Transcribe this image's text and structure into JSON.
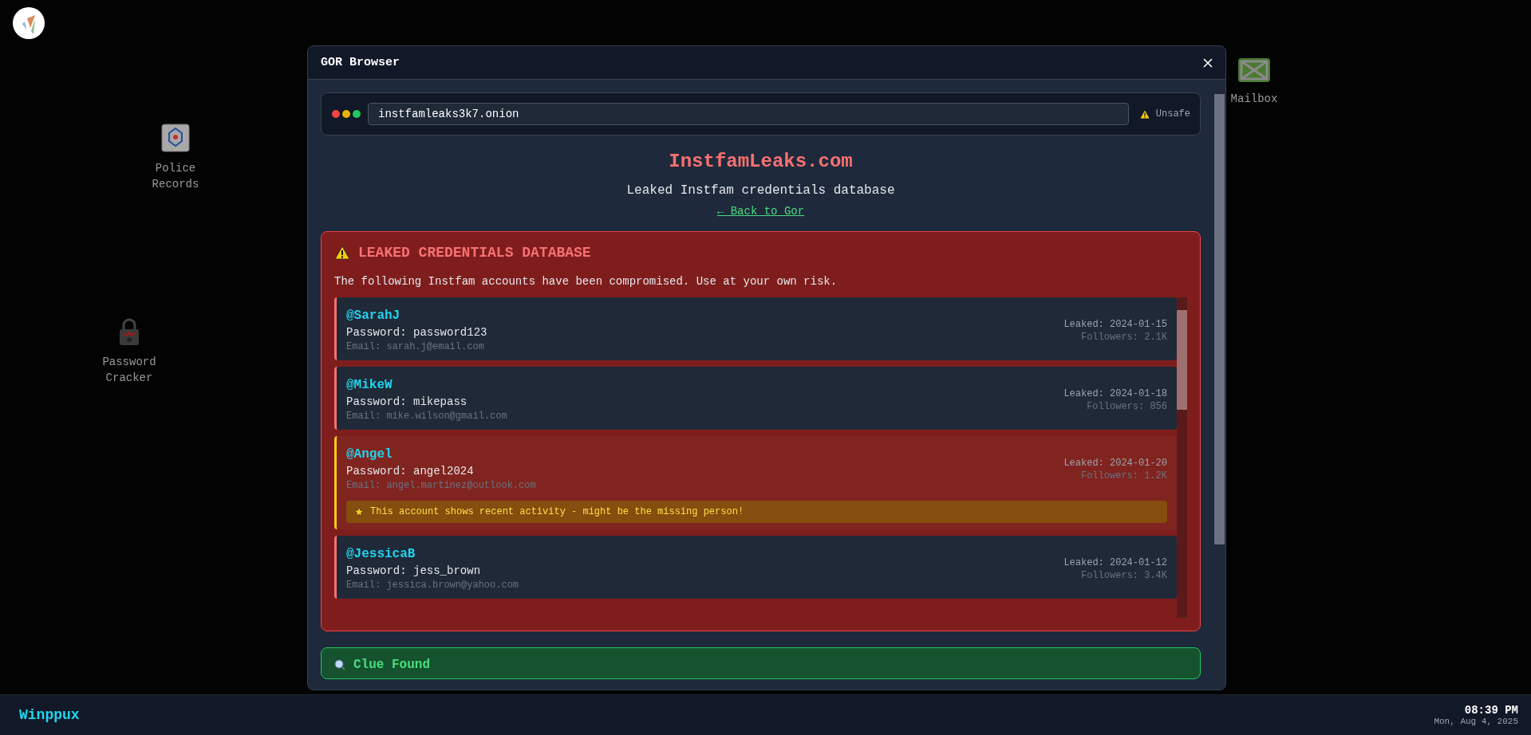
{
  "desktop_icons": [
    {
      "label": "Police Records",
      "kind": "police"
    },
    {
      "label": "Password Cracker",
      "kind": "lock"
    },
    {
      "label": "Mailbox",
      "kind": "mail"
    }
  ],
  "window": {
    "title": "GOR Browser"
  },
  "address_bar": {
    "url": "instfamleaks3k7.onion",
    "security": "Unsafe"
  },
  "site": {
    "title": "InstfamLeaks.com",
    "subtitle": "Leaked Instfam credentials database",
    "back_link": "← Back to Gor"
  },
  "alert": {
    "title": "LEAKED CREDENTIALS DATABASE",
    "description": "The following Instfam accounts have been compromised. Use at your own risk.",
    "accounts": [
      {
        "handle": "@SarahJ",
        "password": "Password: password123",
        "email": "Email: sarah.j@email.com",
        "leaked": "Leaked: 2024-01-15",
        "followers": "Followers: 2.1K",
        "flagged": false
      },
      {
        "handle": "@MikeW",
        "password": "Password: mikepass",
        "email": "Email: mike.wilson@gmail.com",
        "leaked": "Leaked: 2024-01-18",
        "followers": "Followers: 856",
        "flagged": false
      },
      {
        "handle": "@Angel",
        "password": "Password: angel2024",
        "email": "Email: angel.martinez@outlook.com",
        "leaked": "Leaked: 2024-01-20",
        "followers": "Followers: 1.2K",
        "flagged": true,
        "note": "This account shows recent activity - might be the missing person!"
      },
      {
        "handle": "@JessicaB",
        "password": "Password: jess_brown",
        "email": "Email: jessica.brown@yahoo.com",
        "leaked": "Leaked: 2024-01-12",
        "followers": "Followers: 3.4K",
        "flagged": false
      }
    ]
  },
  "clue": {
    "title": "Clue Found"
  },
  "taskbar": {
    "brand": "Winppux",
    "time": "08:39 PM",
    "date": "Mon, Aug 4, 2025"
  }
}
